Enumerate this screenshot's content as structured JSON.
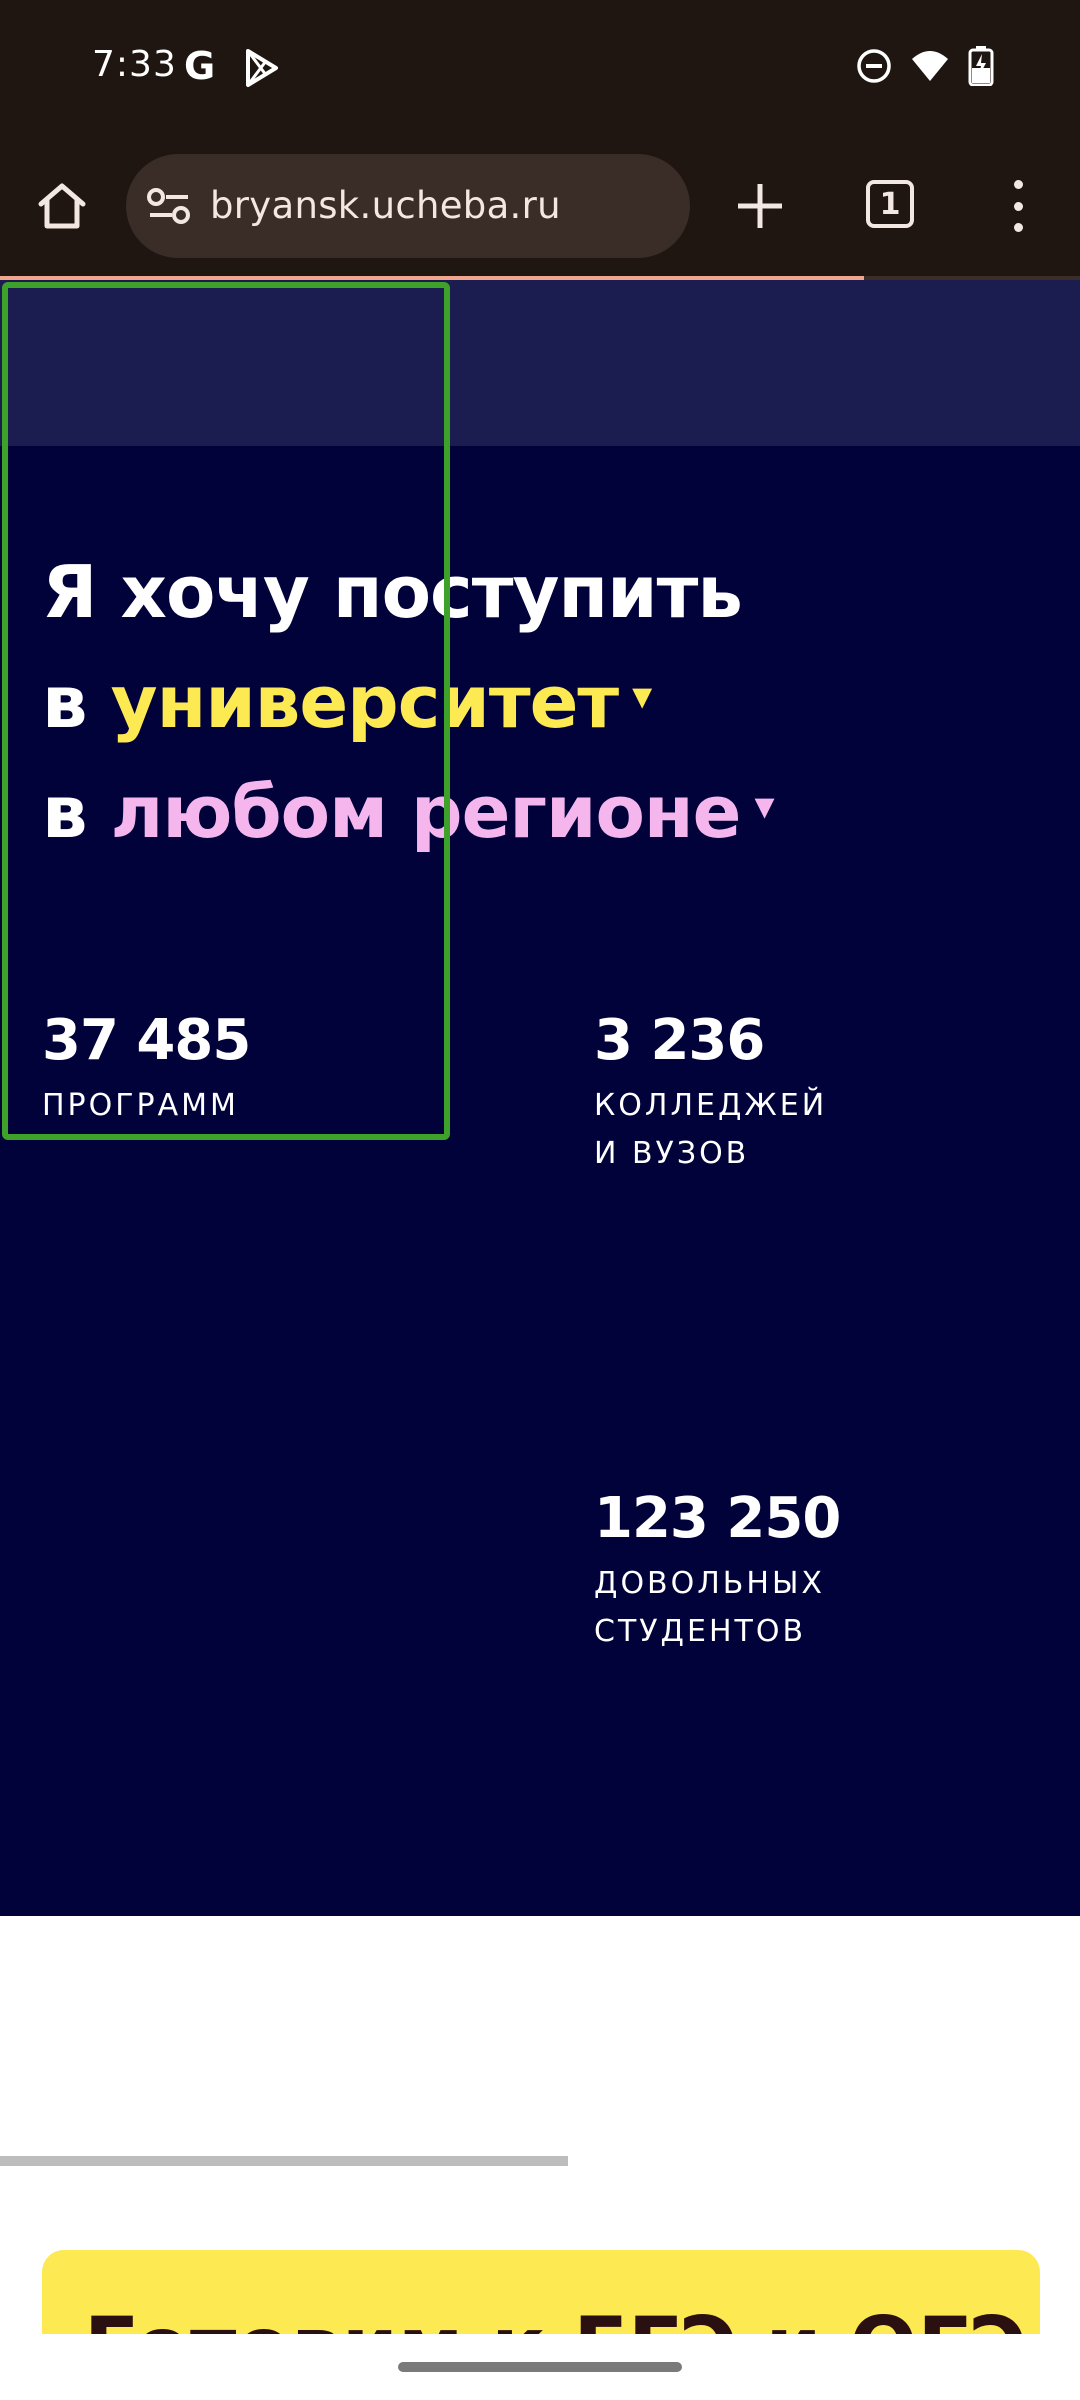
{
  "status_bar": {
    "time": "7:33",
    "google_glyph": "G",
    "icons": [
      "play-store-icon",
      "do-not-disturb-icon",
      "wifi-icon",
      "battery-charging-icon"
    ]
  },
  "browser": {
    "url": "bryansk.ucheba.ru",
    "tab_count": "1",
    "load_progress": 0.8,
    "icons": [
      "home-icon",
      "site-settings-icon",
      "new-tab-icon",
      "tab-switcher-icon",
      "more-menu-icon"
    ]
  },
  "hero": {
    "heading_line1": "Я хочу поступить",
    "heading_prefix_2": "в",
    "institution_type": "университет",
    "heading_prefix_3": "в",
    "region": "любом регионе",
    "caret": "▾"
  },
  "stats": {
    "programs": {
      "number": "37 485",
      "label": "ПРОГРАММ"
    },
    "colleges": {
      "number": "3 236",
      "label_line1": "КОЛЛЕДЖЕЙ",
      "label_line2": "И ВУЗОВ"
    },
    "students": {
      "number": "123 250",
      "label_line1": "ДОВОЛЬНЫХ",
      "label_line2": "СТУДЕНТОВ"
    }
  },
  "promo": {
    "title": "Готовим к ЕГЭ и ОГЭ"
  },
  "colors": {
    "browser_bg": "#1f1612",
    "url_field": "#3a2c27",
    "hero_bg": "#02023a",
    "top_band": "#1b1c4f",
    "accent_yellow": "#fde952",
    "accent_pink": "#f5b6ee",
    "highlight_green": "#3ea12a"
  }
}
